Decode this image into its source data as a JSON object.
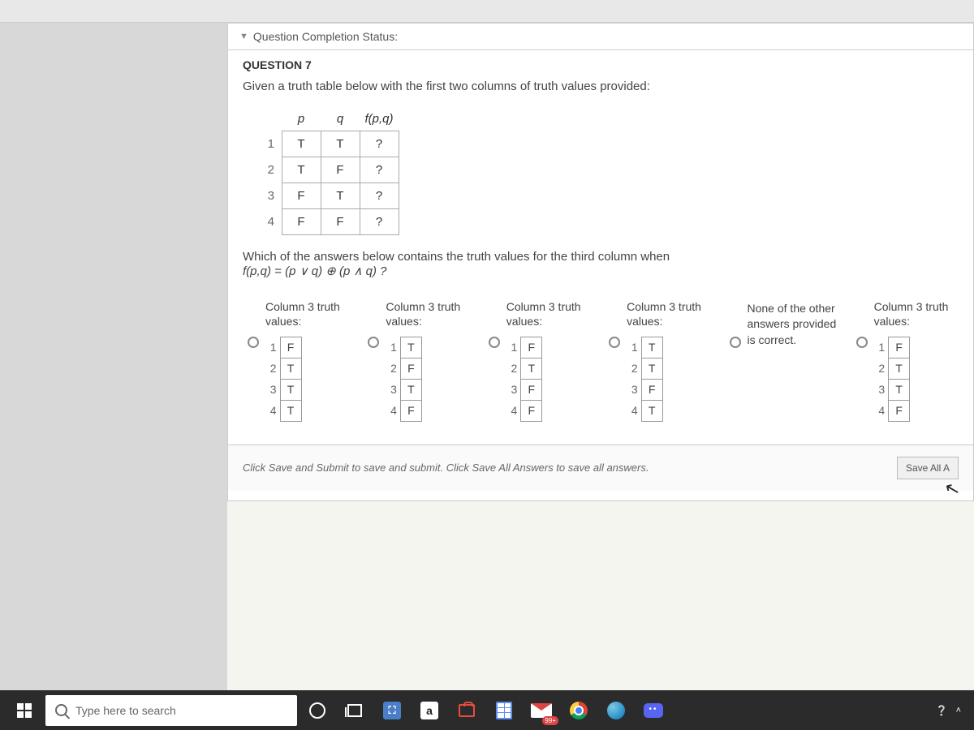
{
  "status_bar": {
    "label": "Question Completion Status:"
  },
  "question": {
    "number_label": "QUESTION 7",
    "prompt": "Given a truth table below with the first two columns of truth values provided:",
    "truth_table": {
      "headers": [
        "",
        "p",
        "q",
        "f(p,q)"
      ],
      "rows": [
        [
          "1",
          "T",
          "T",
          "?"
        ],
        [
          "2",
          "T",
          "F",
          "?"
        ],
        [
          "3",
          "F",
          "T",
          "?"
        ],
        [
          "4",
          "F",
          "F",
          "?"
        ]
      ]
    },
    "sub_prompt_pre": "Which of the answers below contains  the truth values for the third column when",
    "sub_prompt_formula": "f(p,q) = (p ∨ q) ⊕ (p ∧ q) ?",
    "option_heading": "Column 3 truth values:",
    "options": [
      {
        "values": [
          "F",
          "T",
          "T",
          "T"
        ]
      },
      {
        "values": [
          "T",
          "F",
          "T",
          "F"
        ]
      },
      {
        "values": [
          "F",
          "T",
          "F",
          "F"
        ]
      },
      {
        "values": [
          "T",
          "T",
          "F",
          "T"
        ]
      }
    ],
    "none_option": "None of the other answers provided is correct.",
    "extra_option": {
      "values": [
        "F",
        "T",
        "T",
        "F"
      ]
    }
  },
  "footer": {
    "hint": "Click Save and Submit to save and submit. Click Save All Answers to save all answers.",
    "save_all": "Save All A"
  },
  "taskbar": {
    "search_placeholder": "Type here to search",
    "mail_badge": "99+"
  }
}
